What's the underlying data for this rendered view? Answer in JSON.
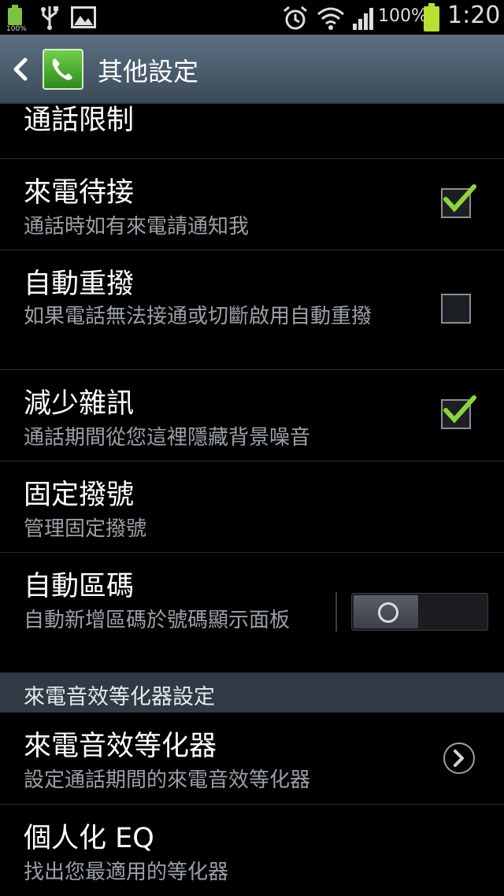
{
  "status_bar": {
    "small_battery_text": "100%",
    "battery_percent": "100%",
    "time": "1:20",
    "icons": [
      "battery-icon",
      "usb-icon",
      "image-icon",
      "alarm-icon",
      "wifi-icon",
      "signal-icon",
      "battery-icon"
    ]
  },
  "action_bar": {
    "title": "其他設定",
    "icons": [
      "back-arrow-icon",
      "phone-app-icon"
    ]
  },
  "items": [
    {
      "title": "通話限制"
    },
    {
      "title": "來電待接",
      "summary": "通話時如有來電請通知我",
      "checked": true
    },
    {
      "title": "自動重撥",
      "summary": "如果電話無法接通或切斷啟用自動重撥",
      "checked": false
    },
    {
      "title": "減少雜訊",
      "summary": "通話期間從您這裡隱藏背景噪音",
      "checked": true
    },
    {
      "title": "固定撥號",
      "summary": "管理固定撥號"
    },
    {
      "title": "自動區碼",
      "summary": "自動新增區碼於號碼顯示面板",
      "toggle_on": false
    },
    {
      "title": "來電音效等化器",
      "summary": "設定通話期間的來電音效等化器"
    },
    {
      "title": "個人化 EQ",
      "summary": "找出您最適用的等化器"
    }
  ],
  "section_header": "來電音效等化器設定",
  "colors": {
    "action_bar": "#4c5d6e",
    "check_mark": "#8fd33a",
    "section_header": "#2f3a45",
    "summary_text": "#9aa0a6"
  }
}
